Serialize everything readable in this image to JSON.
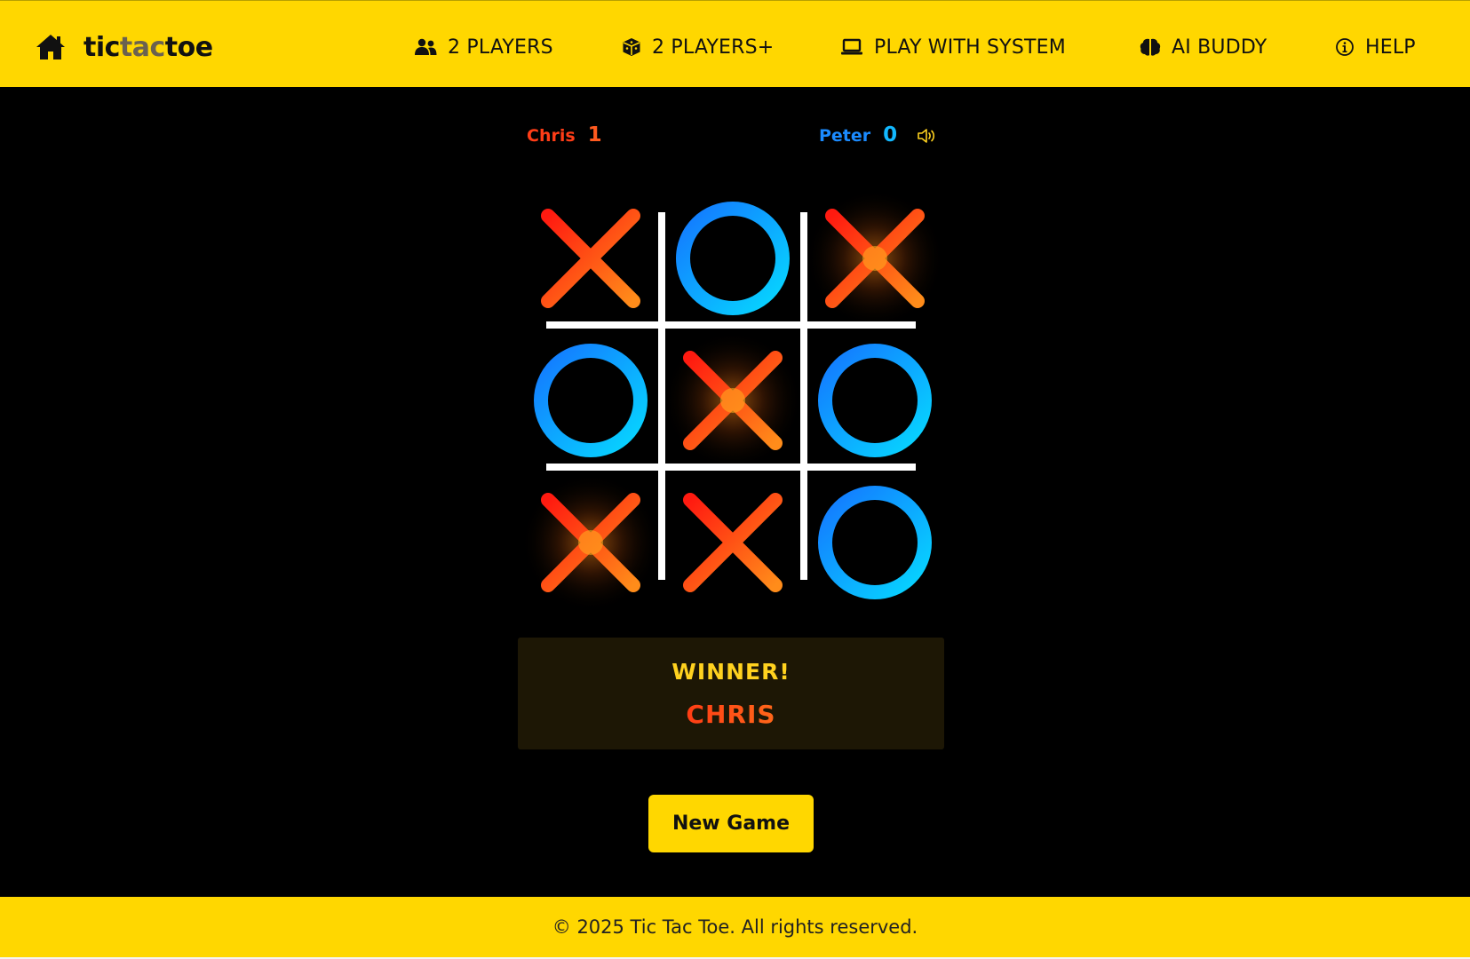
{
  "header": {
    "brand": {
      "part1": "tic",
      "part2": "tac",
      "part3": "toe",
      "home_icon": "home-icon"
    },
    "nav": [
      {
        "label": "2 PLAYERS",
        "icon": "users-icon"
      },
      {
        "label": "2 PLAYERS+",
        "icon": "cube-icon"
      },
      {
        "label": "PLAY WITH SYSTEM",
        "icon": "laptop-icon"
      },
      {
        "label": "AI BUDDY",
        "icon": "brain-icon"
      },
      {
        "label": "HELP",
        "icon": "info-icon"
      }
    ]
  },
  "scoreboard": {
    "player1": {
      "name": "Chris",
      "score": "1",
      "mark": "X"
    },
    "player2": {
      "name": "Peter",
      "score": "0",
      "mark": "O"
    },
    "sound_icon": "speaker-icon"
  },
  "board": {
    "cells": [
      "X",
      "O",
      "X",
      "O",
      "X",
      "O",
      "X",
      "X",
      "O"
    ],
    "winning_line": [
      2,
      4,
      6
    ]
  },
  "result": {
    "label": "WINNER!",
    "winner": "CHRIS"
  },
  "actions": {
    "new_game_label": "New Game"
  },
  "footer": {
    "copyright": "© 2025 Tic Tac Toe. All rights reserved."
  },
  "colors": {
    "accent_yellow": "#ffd700",
    "x_red": "#ff1a10",
    "x_orange": "#ff8c1a",
    "o_blue": "#1476ff",
    "o_cyan": "#06d9ff",
    "panel_bg": "#1d1705",
    "background": "#000000"
  }
}
